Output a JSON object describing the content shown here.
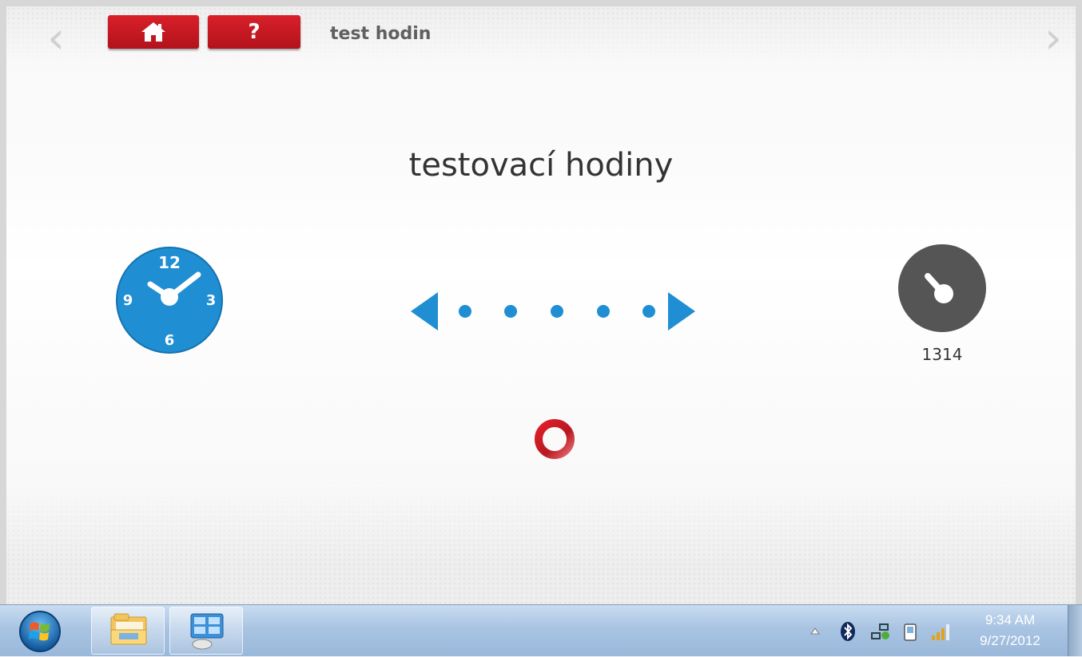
{
  "header": {
    "breadcrumb": "test hodin",
    "help_label": "?",
    "home_icon": "home-icon",
    "prev_icon": "chevron-left-icon",
    "next_icon": "chevron-right-icon"
  },
  "main": {
    "title": "testovací hodiny",
    "tester_clock": {
      "icon": "clock-icon",
      "numerals": [
        "12",
        "3",
        "6",
        "9"
      ],
      "color": "#1f8ed3"
    },
    "device_clock": {
      "icon": "device-clock-icon",
      "value": "1314",
      "color": "#555555"
    },
    "transfer_icon": "bidirectional-transfer-icon",
    "spinner_icon": "loading-ring-icon"
  },
  "taskbar": {
    "start_icon": "windows-start-icon",
    "pinned": [
      {
        "name": "file-explorer",
        "icon": "folder-icon"
      },
      {
        "name": "control-panel",
        "icon": "control-panel-icon"
      }
    ],
    "tray_icons": [
      "show-hidden-icons-icon",
      "bluetooth-icon",
      "network-icon",
      "device-icon",
      "signal-icon"
    ],
    "time": "9:34 AM",
    "date": "9/27/2012"
  }
}
